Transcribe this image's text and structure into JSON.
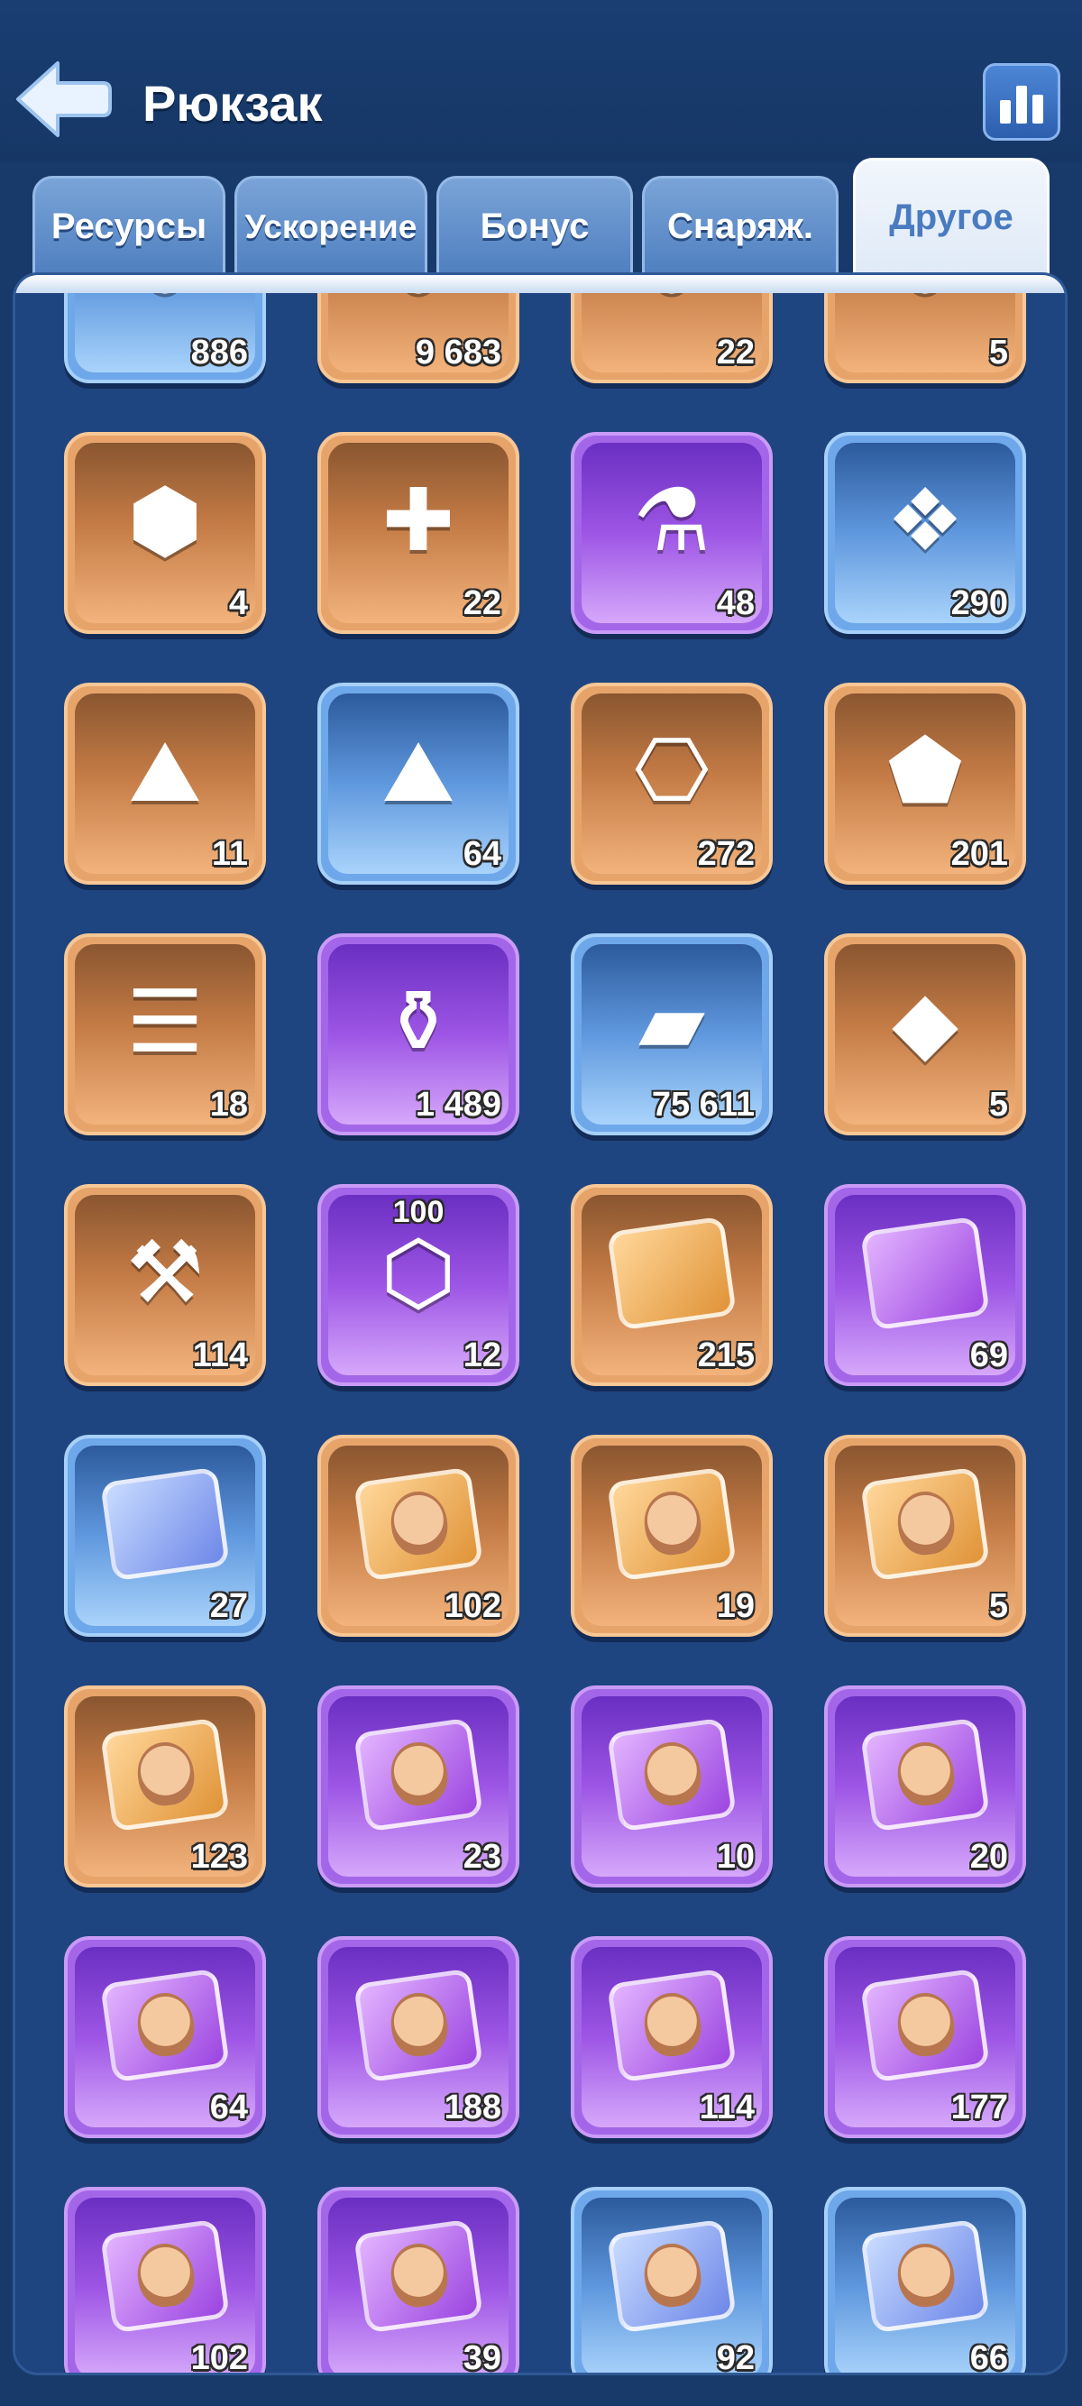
{
  "header": {
    "title": "Рюкзак",
    "back_icon": "arrow-left-icon",
    "stats_icon": "bar-chart-icon"
  },
  "tabs": [
    {
      "label": "Ресурсы",
      "active": false
    },
    {
      "label": "Ускорение",
      "active": false
    },
    {
      "label": "Бонус",
      "active": false
    },
    {
      "label": "Снаряж.",
      "active": false
    },
    {
      "label": "Другое",
      "active": true
    }
  ],
  "colors": {
    "background": "#183a6b",
    "panel": "#1f4580",
    "rarity_orange": "#e7a46a",
    "rarity_purple": "#a466e8",
    "rarity_blue": "#6ea8ea",
    "tab_active_text": "#4a7bc0"
  },
  "items": [
    {
      "count": "886",
      "rarity": "blue",
      "icon": "partial-item-icon"
    },
    {
      "count": "9 683",
      "rarity": "orange",
      "icon": "partial-item-icon"
    },
    {
      "count": "22",
      "rarity": "orange",
      "icon": "partial-item-icon"
    },
    {
      "count": "5",
      "rarity": "orange",
      "icon": "partial-item-icon"
    },
    {
      "count": "4",
      "rarity": "orange",
      "icon": "hero-crystal-icon"
    },
    {
      "count": "22",
      "rarity": "orange",
      "icon": "pet-syringe-icon"
    },
    {
      "count": "48",
      "rarity": "purple",
      "icon": "pet-potion-icon"
    },
    {
      "count": "290",
      "rarity": "blue",
      "icon": "pet-book-icon"
    },
    {
      "count": "11",
      "rarity": "orange",
      "icon": "claw-stone-icon"
    },
    {
      "count": "64",
      "rarity": "blue",
      "icon": "claw-stone-icon"
    },
    {
      "count": "272",
      "rarity": "orange",
      "icon": "gem-scroll-icon"
    },
    {
      "count": "201",
      "rarity": "orange",
      "icon": "gem-book-icon"
    },
    {
      "count": "18",
      "rarity": "orange",
      "icon": "scroll-icon"
    },
    {
      "count": "1 489",
      "rarity": "purple",
      "icon": "potion-bottle-icon"
    },
    {
      "count": "75 611",
      "rarity": "blue",
      "icon": "metal-ingot-icon"
    },
    {
      "count": "5",
      "rarity": "orange",
      "icon": "purple-crystal-icon"
    },
    {
      "count": "114",
      "rarity": "orange",
      "icon": "hammer-stone-icon"
    },
    {
      "count": "12",
      "rarity": "purple",
      "icon": "hex-bolt-icon",
      "top_label": "100"
    },
    {
      "count": "215",
      "rarity": "orange",
      "icon": "puzzle-piece-icon"
    },
    {
      "count": "69",
      "rarity": "purple",
      "icon": "puzzle-piece-icon"
    },
    {
      "count": "27",
      "rarity": "blue",
      "icon": "puzzle-piece-icon"
    },
    {
      "count": "102",
      "rarity": "orange",
      "icon": "hero-puzzle-icon"
    },
    {
      "count": "19",
      "rarity": "orange",
      "icon": "hero-puzzle-icon"
    },
    {
      "count": "5",
      "rarity": "orange",
      "icon": "hero-puzzle-icon"
    },
    {
      "count": "123",
      "rarity": "orange",
      "icon": "hero-puzzle-icon"
    },
    {
      "count": "23",
      "rarity": "purple",
      "icon": "hero-puzzle-icon"
    },
    {
      "count": "10",
      "rarity": "purple",
      "icon": "hero-puzzle-icon"
    },
    {
      "count": "20",
      "rarity": "purple",
      "icon": "hero-puzzle-icon"
    },
    {
      "count": "64",
      "rarity": "purple",
      "icon": "hero-puzzle-icon"
    },
    {
      "count": "188",
      "rarity": "purple",
      "icon": "hero-puzzle-icon"
    },
    {
      "count": "114",
      "rarity": "purple",
      "icon": "hero-puzzle-icon"
    },
    {
      "count": "177",
      "rarity": "purple",
      "icon": "hero-puzzle-icon"
    },
    {
      "count": "102",
      "rarity": "purple",
      "icon": "hero-puzzle-icon"
    },
    {
      "count": "39",
      "rarity": "purple",
      "icon": "hero-puzzle-icon"
    },
    {
      "count": "92",
      "rarity": "blue",
      "icon": "hero-puzzle-icon"
    },
    {
      "count": "66",
      "rarity": "blue",
      "icon": "hero-puzzle-icon"
    }
  ]
}
